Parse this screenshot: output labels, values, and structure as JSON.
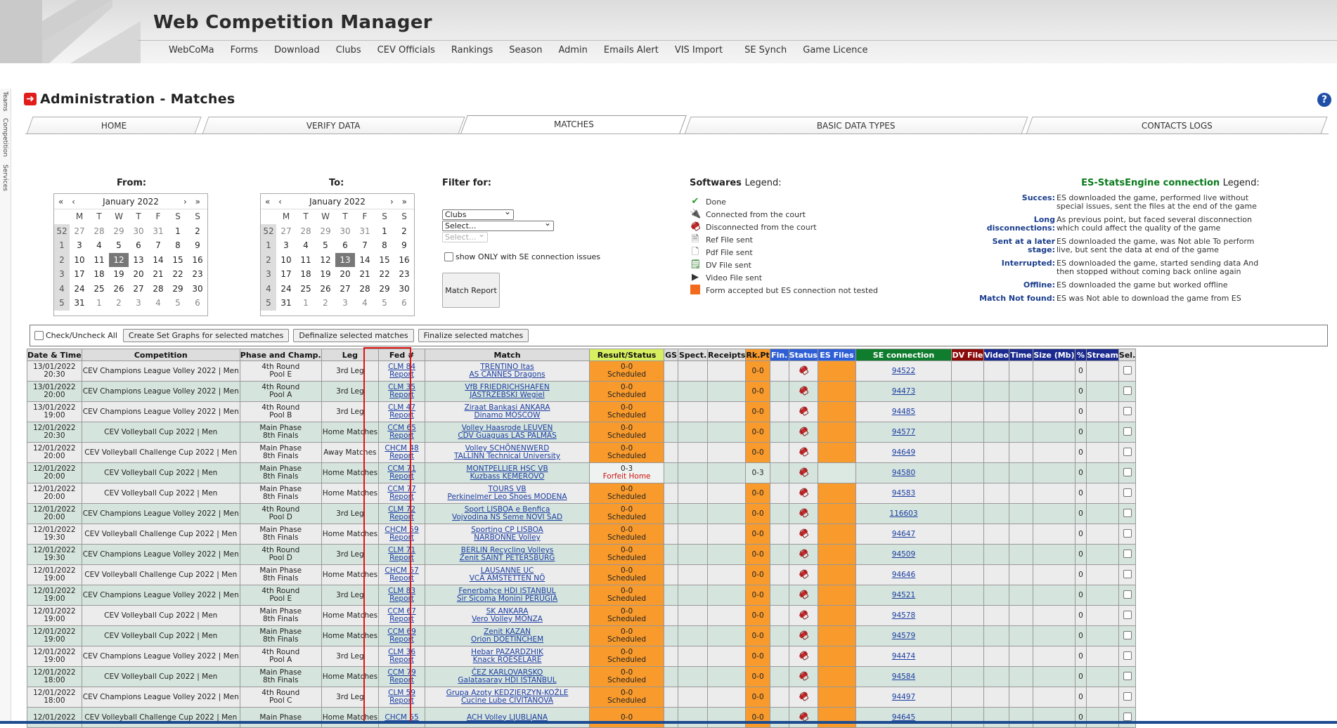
{
  "app": {
    "title": "Web Competition Manager"
  },
  "nav": [
    "WebCoMa",
    "Forms",
    "Download",
    "Clubs",
    "CEV Officials",
    "Rankings",
    "Season",
    "Admin",
    "Emails Alert",
    "VIS Import",
    "SE Synch",
    "Game Licence"
  ],
  "sidetabs": [
    "Teams",
    "Competition",
    "Services"
  ],
  "page": {
    "title": "Administration - Matches",
    "help": "?"
  },
  "tabs": [
    "HOME",
    "VERIFY DATA",
    "MATCHES",
    "BASIC DATA TYPES",
    "CONTACTS LOGS"
  ],
  "active_tab": 2,
  "calendars": [
    {
      "label": "From:",
      "month": "January 2022",
      "nav_prev": "« ‹",
      "nav_next": "› »",
      "dow": [
        "M",
        "T",
        "W",
        "T",
        "F",
        "S",
        "S"
      ],
      "weeks": [
        [
          "52",
          "27",
          "28",
          "29",
          "30",
          "31",
          "1",
          "2"
        ],
        [
          "1",
          "3",
          "4",
          "5",
          "6",
          "7",
          "8",
          "9"
        ],
        [
          "2",
          "10",
          "11",
          "12",
          "13",
          "14",
          "15",
          "16"
        ],
        [
          "3",
          "17",
          "18",
          "19",
          "20",
          "21",
          "22",
          "23"
        ],
        [
          "4",
          "24",
          "25",
          "26",
          "27",
          "28",
          "29",
          "30"
        ],
        [
          "5",
          "31",
          "1",
          "2",
          "3",
          "4",
          "5",
          "6"
        ]
      ],
      "selected": "12"
    },
    {
      "label": "To:",
      "month": "January 2022",
      "nav_prev": "« ‹",
      "nav_next": "› »",
      "dow": [
        "M",
        "T",
        "W",
        "T",
        "F",
        "S",
        "S"
      ],
      "weeks": [
        [
          "52",
          "27",
          "28",
          "29",
          "30",
          "31",
          "1",
          "2"
        ],
        [
          "1",
          "3",
          "4",
          "5",
          "6",
          "7",
          "8",
          "9"
        ],
        [
          "2",
          "10",
          "11",
          "12",
          "13",
          "14",
          "15",
          "16"
        ],
        [
          "3",
          "17",
          "18",
          "19",
          "20",
          "21",
          "22",
          "23"
        ],
        [
          "4",
          "24",
          "25",
          "26",
          "27",
          "28",
          "29",
          "30"
        ],
        [
          "5",
          "31",
          "1",
          "2",
          "3",
          "4",
          "5",
          "6"
        ]
      ],
      "selected": "13"
    }
  ],
  "filter": {
    "label": "Filter for:",
    "type_value": "Clubs",
    "select1": "Select...",
    "select2": "Select...",
    "se_only_label": "show ONLY with SE connection issues",
    "match_report": "Match Report"
  },
  "softwares_legend": {
    "title": "Softwares",
    "suffix": "Legend:",
    "items": [
      {
        "icon": "check-icon",
        "label": "Done"
      },
      {
        "icon": "plug-connected-icon",
        "label": "Connected from the court"
      },
      {
        "icon": "plug-disconnected-icon",
        "label": "Disconnected from the court"
      },
      {
        "icon": "ref-file-icon",
        "label": "Ref File sent"
      },
      {
        "icon": "pdf-file-icon",
        "label": "Pdf File sent"
      },
      {
        "icon": "dv-file-icon",
        "label": "DV File sent"
      },
      {
        "icon": "video-file-icon",
        "label": "Video File sent"
      },
      {
        "icon": "orange-square-icon",
        "label": "Form accepted but ES connection not tested"
      }
    ]
  },
  "es_legend": {
    "title": "ES-StatsEngine connection",
    "suffix": "Legend:",
    "items": [
      {
        "key": "Succes:",
        "text": "ES downloaded the game, performed live without special issues, sent the files at the end of the game"
      },
      {
        "key": "Long disconnections:",
        "text": "As previous point, but faced several disconnection which could affect the quality of the game"
      },
      {
        "key": "Sent at a later stage:",
        "text": "ES downloaded the game, was Not able To perform live, but sent the data at end of the game"
      },
      {
        "key": "Interrupted:",
        "text": "ES downloaded the game, started sending data And then stopped without coming back online again"
      },
      {
        "key": "Offline:",
        "text": "ES downloaded the game but worked offline"
      },
      {
        "key": "Match Not found:",
        "text": "ES was Not able to download the game from ES"
      }
    ]
  },
  "actions": {
    "check_all": "Check/Uncheck All",
    "create_graphs": "Create Set Graphs for selected matches",
    "definalize": "Definalize selected matches",
    "finalize": "Finalize selected matches"
  },
  "columns": [
    "Date & Time",
    "Competition",
    "Phase and Champ.",
    "Leg",
    "Fed #",
    "Match",
    "Result/Status",
    "GS",
    "Spect.",
    "Receipts",
    "Rk.Pt",
    "Fin.",
    "Status",
    "ES Files",
    "SE connection",
    "DV File",
    "Video",
    "Time",
    "Size (Mb)",
    "%",
    "Stream",
    "Sel."
  ],
  "rows": [
    {
      "date": "13/01/2022",
      "time": "20:30",
      "comp": "CEV Champions League Volley 2022 | Men",
      "phase": "4th Round",
      "pool": "Pool E",
      "leg": "3rd Leg",
      "fed": "CLM 84",
      "report": "Report",
      "home": "TRENTINO Itas",
      "away": "AS CANNES Dragons",
      "score": "0-0",
      "status": "Scheduled",
      "rk": "0-0",
      "se": "94522",
      "pct": "0"
    },
    {
      "date": "13/01/2022",
      "time": "20:00",
      "comp": "CEV Champions League Volley 2022 | Men",
      "phase": "4th Round",
      "pool": "Pool A",
      "leg": "3rd Leg",
      "fed": "CLM 35",
      "report": "Report",
      "home": "VfB FRIEDRICHSHAFEN",
      "away": "JASTRZEBSKI Wegiel",
      "score": "0-0",
      "status": "Scheduled",
      "rk": "0-0",
      "se": "94473",
      "pct": "0"
    },
    {
      "date": "13/01/2022",
      "time": "19:00",
      "comp": "CEV Champions League Volley 2022 | Men",
      "phase": "4th Round",
      "pool": "Pool B",
      "leg": "3rd Leg",
      "fed": "CLM 47",
      "report": "Report",
      "home": "Ziraat Bankasi ANKARA",
      "away": "Dinamo MOSCOW",
      "score": "0-0",
      "status": "Scheduled",
      "rk": "0-0",
      "se": "94485",
      "pct": "0"
    },
    {
      "date": "12/01/2022",
      "time": "20:30",
      "comp": "CEV Volleyball Cup 2022 | Men",
      "phase": "Main Phase",
      "pool": "8th Finals",
      "leg": "Home Matches",
      "fed": "CCM 65",
      "report": "Report",
      "home": "Volley Haasrode LEUVEN",
      "away": "CDV Guaguas LAS PALMAS",
      "score": "0-0",
      "status": "Scheduled",
      "rk": "0-0",
      "se": "94577",
      "pct": "0"
    },
    {
      "date": "12/01/2022",
      "time": "20:00",
      "comp": "CEV Volleyball Challenge Cup 2022 | Men",
      "phase": "Main Phase",
      "pool": "8th Finals",
      "leg": "Away Matches",
      "fed": "CHCM 48",
      "report": "Report",
      "home": "Volley SCHÖNENWERD",
      "away": "TALLINN Technical University",
      "score": "0-0",
      "status": "Scheduled",
      "rk": "0-0",
      "se": "94649",
      "pct": "0"
    },
    {
      "date": "12/01/2022",
      "time": "20:00",
      "comp": "CEV Volleyball Cup 2022 | Men",
      "phase": "Main Phase",
      "pool": "8th Finals",
      "leg": "Home Matches",
      "fed": "CCM 71",
      "report": "Report",
      "home": "MONTPELLIER HSC VB",
      "away": "Kuzbass KEMEROVO",
      "score": "0-3",
      "status": "Forfeit Home",
      "rk": "0-3",
      "se": "94580",
      "pct": "0",
      "forfeit": true
    },
    {
      "date": "12/01/2022",
      "time": "20:00",
      "comp": "CEV Volleyball Cup 2022 | Men",
      "phase": "Main Phase",
      "pool": "8th Finals",
      "leg": "Home Matches",
      "fed": "CCM 77",
      "report": "Report",
      "home": "TOURS VB",
      "away": "Perkinelmer Leo Shoes MODENA",
      "score": "0-0",
      "status": "Scheduled",
      "rk": "0-0",
      "se": "94583",
      "pct": "0"
    },
    {
      "date": "12/01/2022",
      "time": "20:00",
      "comp": "CEV Champions League Volley 2022 | Men",
      "phase": "4th Round",
      "pool": "Pool D",
      "leg": "3rd Leg",
      "fed": "CLM 72",
      "report": "Report",
      "home": "Sport LISBOA e Benfica",
      "away": "Vojvodina NS Seme NOVI SAD",
      "score": "0-0",
      "status": "Scheduled",
      "rk": "0-0",
      "se": "116603",
      "pct": "0"
    },
    {
      "date": "12/01/2022",
      "time": "19:30",
      "comp": "CEV Volleyball Challenge Cup 2022 | Men",
      "phase": "Main Phase",
      "pool": "8th Finals",
      "leg": "Home Matches",
      "fed": "CHCM 59",
      "report": "Report",
      "home": "Sporting CP LISBOA",
      "away": "NARBONNE Volley",
      "score": "0-0",
      "status": "Scheduled",
      "rk": "0-0",
      "se": "94647",
      "pct": "0"
    },
    {
      "date": "12/01/2022",
      "time": "19:30",
      "comp": "CEV Champions League Volley 2022 | Men",
      "phase": "4th Round",
      "pool": "Pool D",
      "leg": "3rd Leg",
      "fed": "CLM 71",
      "report": "Report",
      "home": "BERLIN Recycling Volleys",
      "away": "Zenit SAINT PETERSBURG",
      "score": "0-0",
      "status": "Scheduled",
      "rk": "0-0",
      "se": "94509",
      "pct": "0"
    },
    {
      "date": "12/01/2022",
      "time": "19:00",
      "comp": "CEV Volleyball Challenge Cup 2022 | Men",
      "phase": "Main Phase",
      "pool": "8th Finals",
      "leg": "Home Matches",
      "fed": "CHCM 57",
      "report": "Report",
      "home": "LAUSANNE UC",
      "away": "VCA AMSTETTEN NÖ",
      "score": "0-0",
      "status": "Scheduled",
      "rk": "0-0",
      "se": "94646",
      "pct": "0"
    },
    {
      "date": "12/01/2022",
      "time": "19:00",
      "comp": "CEV Champions League Volley 2022 | Men",
      "phase": "4th Round",
      "pool": "Pool E",
      "leg": "3rd Leg",
      "fed": "CLM 83",
      "report": "Report",
      "home": "Fenerbahçe HDI ISTANBUL",
      "away": "Sir Sicoma Monini PERUGIA",
      "score": "0-0",
      "status": "Scheduled",
      "rk": "0-0",
      "se": "94521",
      "pct": "0"
    },
    {
      "date": "12/01/2022",
      "time": "19:00",
      "comp": "CEV Volleyball Cup 2022 | Men",
      "phase": "Main Phase",
      "pool": "8th Finals",
      "leg": "Home Matches",
      "fed": "CCM 67",
      "report": "Report",
      "home": "SK ANKARA",
      "away": "Vero Volley MONZA",
      "score": "0-0",
      "status": "Scheduled",
      "rk": "0-0",
      "se": "94578",
      "pct": "0"
    },
    {
      "date": "12/01/2022",
      "time": "19:00",
      "comp": "CEV Volleyball Cup 2022 | Men",
      "phase": "Main Phase",
      "pool": "8th Finals",
      "leg": "Home Matches",
      "fed": "CCM 69",
      "report": "Report",
      "home": "Zenit KAZAN",
      "away": "Orion DOETINCHEM",
      "score": "0-0",
      "status": "Scheduled",
      "rk": "0-0",
      "se": "94579",
      "pct": "0"
    },
    {
      "date": "12/01/2022",
      "time": "19:00",
      "comp": "CEV Champions League Volley 2022 | Men",
      "phase": "4th Round",
      "pool": "Pool A",
      "leg": "3rd Leg",
      "fed": "CLM 36",
      "report": "Report",
      "home": "Hebar PAZARDZHIK",
      "away": "Knack ROESELARE",
      "score": "0-0",
      "status": "Scheduled",
      "rk": "0-0",
      "se": "94474",
      "pct": "0"
    },
    {
      "date": "12/01/2022",
      "time": "18:00",
      "comp": "CEV Volleyball Cup 2022 | Men",
      "phase": "Main Phase",
      "pool": "8th Finals",
      "leg": "Home Matches",
      "fed": "CCM 79",
      "report": "Report",
      "home": "ČEZ KARLOVARSKO",
      "away": "Galatasaray HDI ISTANBUL",
      "score": "0-0",
      "status": "Scheduled",
      "rk": "0-0",
      "se": "94584",
      "pct": "0"
    },
    {
      "date": "12/01/2022",
      "time": "18:00",
      "comp": "CEV Champions League Volley 2022 | Men",
      "phase": "4th Round",
      "pool": "Pool C",
      "leg": "3rd Leg",
      "fed": "CLM 59",
      "report": "Report",
      "home": "Grupa Azoty KEDZIERZYN-KOŹLE",
      "away": "Cucine Lube CIVITANOVA",
      "score": "0-0",
      "status": "Scheduled",
      "rk": "0-0",
      "se": "94497",
      "pct": "0"
    },
    {
      "date": "12/01/2022",
      "time": "",
      "comp": "CEV Volleyball Challenge Cup 2022 | Men",
      "phase": "Main Phase",
      "pool": "",
      "leg": "Home Matches",
      "fed": "CHCM 55",
      "report": "",
      "home": "ACH Volley LJUBLJANA",
      "away": "",
      "score": "0-0",
      "status": "",
      "rk": "0-0",
      "se": "94645",
      "pct": "0"
    }
  ],
  "colors": {
    "orange": "#f89a2c",
    "header_green": "#0f7d2d",
    "header_blue": "#2f5fd6",
    "header_navy": "#1b2a8f",
    "header_maroon": "#8b0a0a",
    "highlight": "#e21313"
  }
}
